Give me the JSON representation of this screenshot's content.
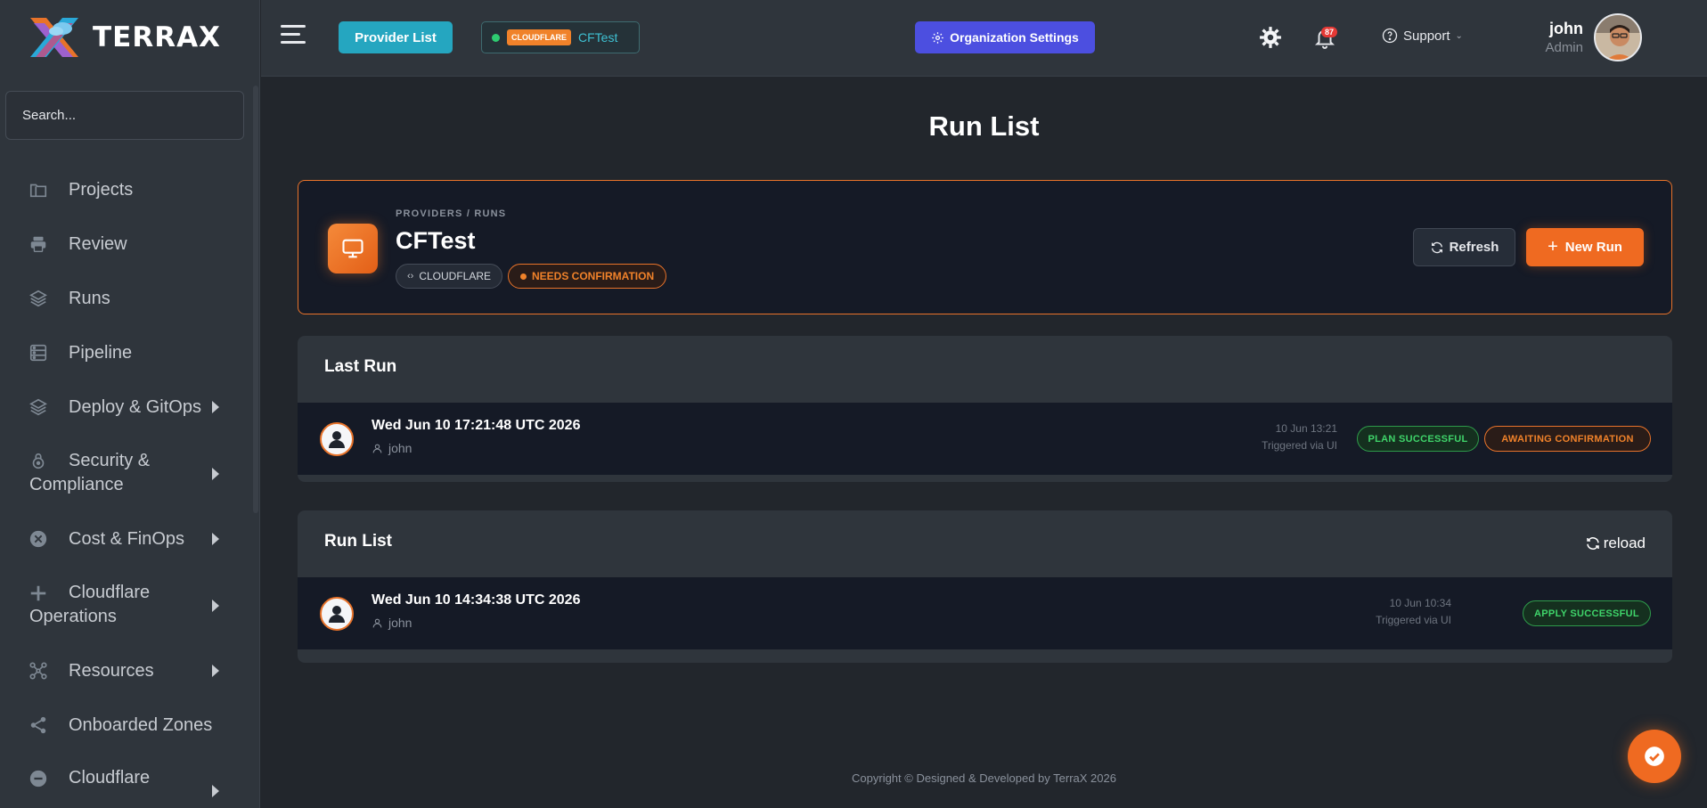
{
  "brand": {
    "name": "TERRAX"
  },
  "sidebar": {
    "search_placeholder": "Search...",
    "items": [
      {
        "label": "Projects"
      },
      {
        "label": "Review"
      },
      {
        "label": "Runs"
      },
      {
        "label": "Pipeline"
      },
      {
        "label": "Deploy & GitOps"
      },
      {
        "label": "Security & Compliance"
      },
      {
        "label": "Cost & FinOps"
      },
      {
        "label": "Cloudflare Operations"
      },
      {
        "label": "Resources"
      },
      {
        "label": "Onboarded Zones"
      },
      {
        "label": "Cloudflare"
      }
    ]
  },
  "topbar": {
    "provider_list_label": "Provider List",
    "provider_chip": {
      "tag": "CLOUDFLARE",
      "name": "CFTest"
    },
    "org_settings_label": "Organization Settings",
    "notification_count": "87",
    "support_label": "Support",
    "user": {
      "name": "john",
      "role": "Admin"
    }
  },
  "page": {
    "title": "Run List",
    "breadcrumb": "PROVIDERS / RUNS",
    "provider_name": "CFTest",
    "provider_tag": "CLOUDFLARE",
    "status_tag": "NEEDS CONFIRMATION",
    "refresh_label": "Refresh",
    "new_run_label": "New Run"
  },
  "last_run": {
    "section_title": "Last Run",
    "title": "Wed Jun 10 17:21:48 UTC 2026",
    "user": "john",
    "date": "10 Jun 13:21",
    "trigger": "Triggered via UI",
    "badges": [
      "PLAN SUCCESSFUL",
      "AWAITING CONFIRMATION"
    ]
  },
  "run_list": {
    "section_title": "Run List",
    "reload_label": "reload",
    "rows": [
      {
        "title": "Wed Jun 10 14:34:38 UTC 2026",
        "user": "john",
        "date": "10 Jun 10:34",
        "trigger": "Triggered via UI",
        "badge": "APPLY SUCCESSFUL"
      }
    ]
  },
  "footer": {
    "text": "Copyright © Designed & Developed by TerraX 2026"
  },
  "colors": {
    "accent": "#ef6a21",
    "provider_button": "#25a6c0",
    "org_button": "#4c4fe0",
    "success": "#3fd46a"
  }
}
